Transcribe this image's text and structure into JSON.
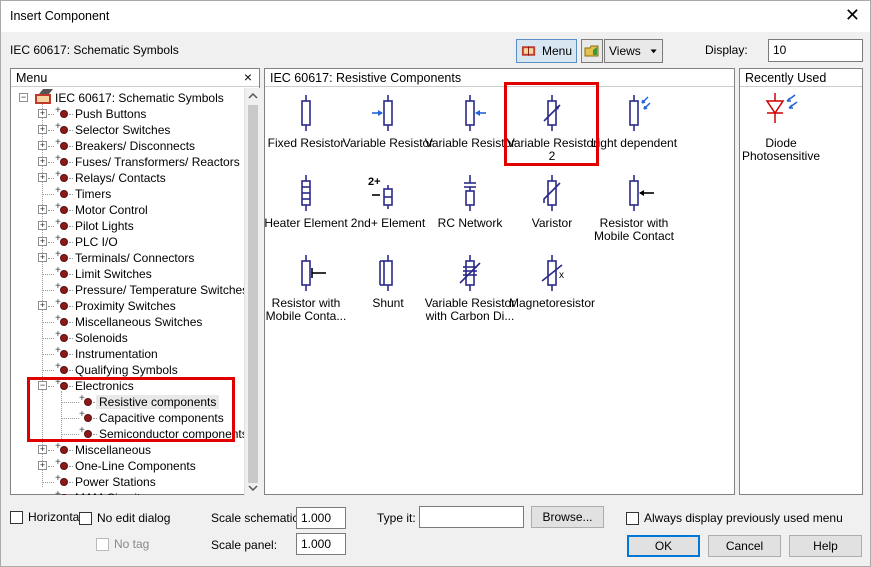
{
  "window": {
    "title": "Insert Component",
    "close_glyph": "✕"
  },
  "toolbar": {
    "library": "IEC 60617: Schematic Symbols",
    "menu_label": "Menu",
    "views_label": "Views",
    "display_label": "Display:",
    "display_value": "10"
  },
  "menu_panel": {
    "header": "Menu",
    "close": "×",
    "root": "IEC 60617: Schematic Symbols",
    "items": [
      {
        "label": "Push Buttons"
      },
      {
        "label": "Selector Switches"
      },
      {
        "label": "Breakers/ Disconnects"
      },
      {
        "label": "Fuses/ Transformers/ Reactors"
      },
      {
        "label": "Relays/ Contacts"
      },
      {
        "label": "Timers"
      },
      {
        "label": "Motor Control"
      },
      {
        "label": "Pilot Lights"
      },
      {
        "label": "PLC I/O"
      },
      {
        "label": "Terminals/ Connectors"
      },
      {
        "label": "Limit Switches"
      },
      {
        "label": "Pressure/ Temperature Switches"
      },
      {
        "label": "Proximity Switches"
      },
      {
        "label": "Miscellaneous Switches"
      },
      {
        "label": "Solenoids"
      },
      {
        "label": "Instrumentation"
      },
      {
        "label": "Qualifying Symbols"
      },
      {
        "label": "Electronics"
      },
      {
        "label": "Resistive components"
      },
      {
        "label": "Capacitive components"
      },
      {
        "label": "Semiconductor components"
      },
      {
        "label": "Miscellaneous"
      },
      {
        "label": "One-Line Components"
      },
      {
        "label": "Power Stations"
      },
      {
        "label": "MAM Circuits"
      }
    ]
  },
  "components_panel": {
    "header": "IEC 60617: Resistive Components",
    "items": [
      {
        "line1": "Fixed Resistor",
        "line2": ""
      },
      {
        "line1": "Variable Resistor",
        "line2": ""
      },
      {
        "line1": "Variable Resistor",
        "line2": ""
      },
      {
        "line1": "Variable Resistor",
        "line2": "2"
      },
      {
        "line1": "Light dependent",
        "line2": ""
      },
      {
        "line1": "Heater Element",
        "line2": ""
      },
      {
        "line1": "2nd+ Element",
        "line2": ""
      },
      {
        "line1": "RC Network",
        "line2": ""
      },
      {
        "line1": "Varistor",
        "line2": ""
      },
      {
        "line1": "Resistor with",
        "line2": "Mobile Contact"
      },
      {
        "line1": "Resistor with",
        "line2": "Mobile Conta..."
      },
      {
        "line1": "Shunt",
        "line2": ""
      },
      {
        "line1": "Variable Resistor",
        "line2": "with Carbon Di..."
      },
      {
        "line1": "Magnetoresistor",
        "line2": ""
      }
    ],
    "second_element_glyph": "2+"
  },
  "recent_panel": {
    "header": "Recently Used",
    "items": [
      {
        "line1": "Diode",
        "line2": "Photosensitive"
      }
    ]
  },
  "bottom": {
    "horizontal": "Horizontal",
    "no_edit_dialog": "No edit dialog",
    "no_tag": "No tag",
    "scale_schematic_label": "Scale schematic:",
    "scale_schematic_value": "1.000",
    "scale_panel_label": "Scale panel:",
    "scale_panel_value": "1.000",
    "type_it_label": "Type it:",
    "type_it_value": "",
    "browse": "Browse...",
    "always_display": "Always display previously used menu",
    "ok": "OK",
    "cancel": "Cancel",
    "help": "Help"
  },
  "colors": {
    "accent": "#0078d7",
    "highlight": "#e00000",
    "symbol": "#2a2a8a"
  }
}
